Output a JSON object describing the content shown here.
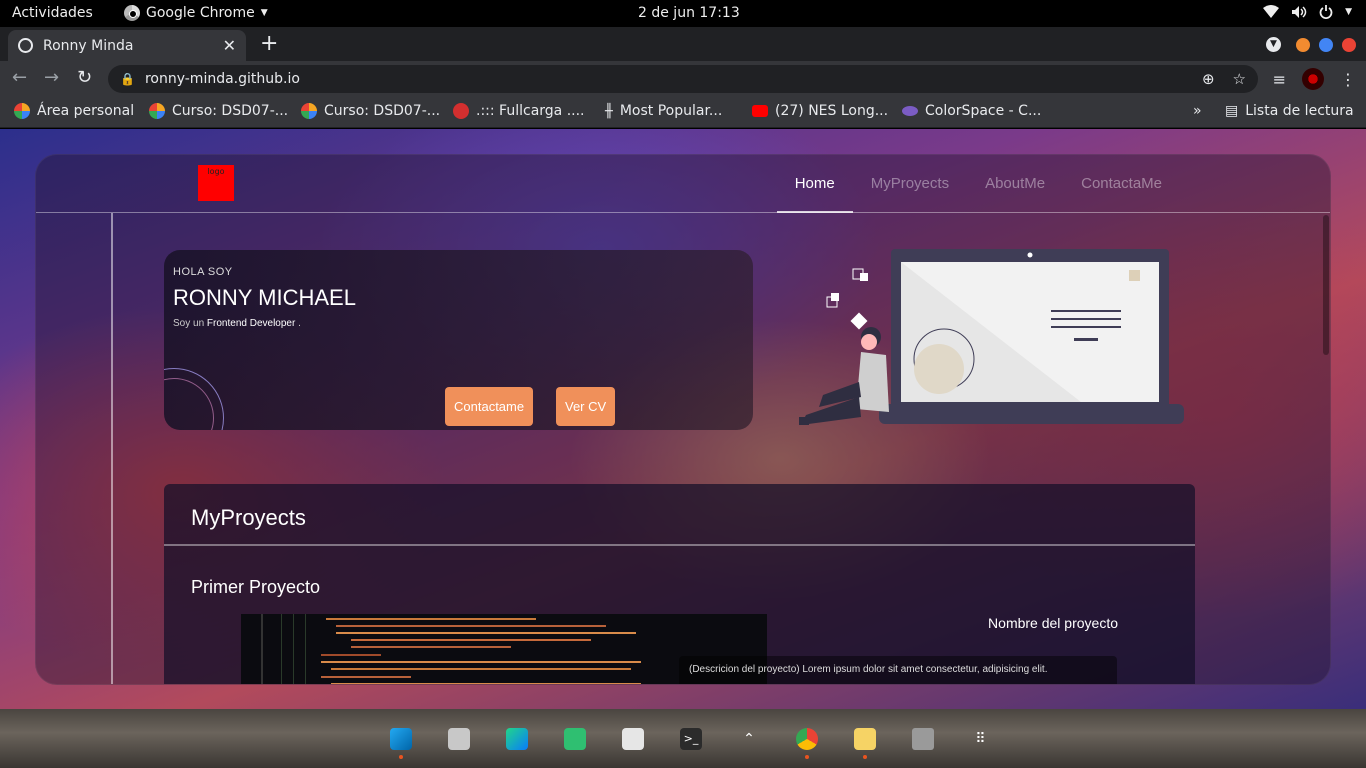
{
  "topbar": {
    "activities": "Actividades",
    "app_name": "Google Chrome",
    "clock": "2 de jun  17:13"
  },
  "tabs": [
    {
      "title": "Ronny Minda"
    }
  ],
  "toolbar": {
    "url": "ronny-minda.github.io"
  },
  "bookmarks": {
    "items": [
      {
        "label": "Área personal",
        "icon": "moodle-icon"
      },
      {
        "label": "Curso: DSD07-...",
        "icon": "moodle-icon"
      },
      {
        "label": "Curso: DSD07-...",
        "icon": "moodle-icon"
      },
      {
        "label": ".::: Fullcarga ....",
        "icon": "fullcarga-icon"
      },
      {
        "label": "Most Popular...",
        "icon": "bars-icon"
      },
      {
        "label": "(27) NES Long...",
        "icon": "youtube-icon"
      },
      {
        "label": "ColorSpace - C...",
        "icon": "colorspace-icon"
      }
    ],
    "overflow": "»",
    "reading_list": "Lista de lectura"
  },
  "page": {
    "logo_text": "logo",
    "nav": [
      {
        "label": "Home",
        "active": true
      },
      {
        "label": "MyProyects",
        "active": false
      },
      {
        "label": "AboutMe",
        "active": false
      },
      {
        "label": "ContactaMe",
        "active": false
      }
    ],
    "hero": {
      "greeting": "HOLA SOY",
      "name": "RONNY MICHAEL",
      "role_prefix": "Soy un",
      "role": "Frontend Developer",
      "role_suffix": ".",
      "btn_contact": "Contactame",
      "btn_cv": "Ver CV"
    },
    "projects": {
      "title": "MyProyects",
      "first_title": "Primer Proyecto",
      "project_name": "Nombre del proyecto",
      "project_desc": "(Descricion del proyecto) Lorem ipsum dolor sit amet consectetur, adipisicing elit."
    }
  },
  "colors": {
    "accent_button": "#f0905a",
    "logo": "#ff0000",
    "close_dot": "#ea4335",
    "max_dot": "#4285f4",
    "min_dot": "#f28b30"
  },
  "dock": [
    {
      "name": "vscode-icon",
      "running": true
    },
    {
      "name": "files-icon",
      "running": false
    },
    {
      "name": "pycharm-icon",
      "running": false
    },
    {
      "name": "extensions-icon",
      "running": false
    },
    {
      "name": "settings-app-icon",
      "running": false
    },
    {
      "name": "terminal-icon",
      "running": false
    },
    {
      "name": "tray-arrow-icon",
      "running": false
    },
    {
      "name": "chrome-icon",
      "running": true
    },
    {
      "name": "text-editor-icon",
      "running": true
    },
    {
      "name": "trash-icon",
      "running": false
    },
    {
      "name": "app-grid-icon",
      "running": false
    }
  ]
}
